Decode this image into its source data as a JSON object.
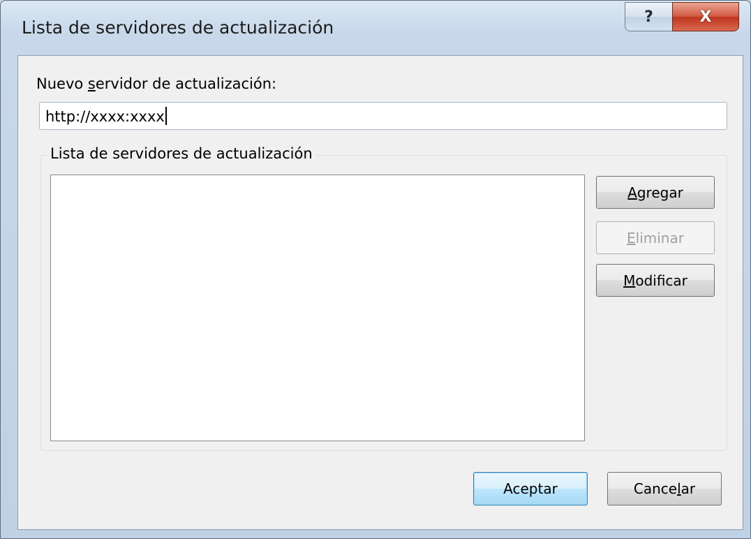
{
  "window": {
    "title": "Lista de servidores de actualización",
    "help_glyph": "?",
    "close_glyph": "X"
  },
  "new_server": {
    "label_before": "Nuevo ",
    "label_accel": "s",
    "label_after": "ervidor de actualización:",
    "value": "http://xxxx:xxxx"
  },
  "server_list": {
    "group_title": "Lista de servidores de actualización",
    "items": []
  },
  "side_buttons": {
    "add": {
      "accel": "A",
      "rest": "gregar"
    },
    "remove": {
      "accel": "E",
      "rest": "liminar"
    },
    "modify": {
      "accel": "M",
      "rest": "odificar"
    }
  },
  "footer": {
    "ok_label": "Aceptar",
    "cancel_before": "Cance",
    "cancel_accel": "l",
    "cancel_after": "ar"
  },
  "colors": {
    "close_button": "#c0361f",
    "default_button_border": "#3c7fb1"
  }
}
